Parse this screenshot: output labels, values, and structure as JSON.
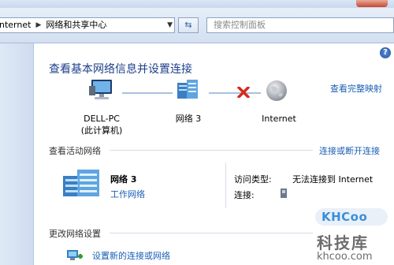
{
  "window": {
    "breadcrumb_start": "nternet",
    "breadcrumb_current": "网络和共享中心",
    "search_placeholder": "搜索控制面板"
  },
  "main": {
    "title": "查看基本网络信息并设置连接",
    "full_map_link": "查看完整映射",
    "map": {
      "computer_name": "DELL-PC",
      "computer_sub": "(此计算机)",
      "network_name": "网络  3",
      "internet_name": "Internet"
    },
    "active_networks": {
      "title": "查看活动网络",
      "connect_link": "连接或断开连接",
      "network_name": "网络  3",
      "network_type": "工作网络",
      "access_type_label": "访问类型:",
      "access_type_value": "无法连接到 Internet",
      "connections_label": "连接:"
    },
    "change_settings": {
      "title": "更改网络设置",
      "setup_link": "设置新的连接或网络"
    }
  },
  "watermark": {
    "logo_text": "KHCoo",
    "cn_text": "科技库",
    "domain": "khcoo.com"
  },
  "colors": {
    "link": "#1b5fb4",
    "title": "#1e3f8a",
    "error_x": "#d62a1f"
  },
  "icons": [
    "back-icon",
    "breadcrumb-separator-icon",
    "dropdown-arrow-icon",
    "refresh-icon",
    "help-icon",
    "computer-icon",
    "network-icon",
    "red-x-icon",
    "globe-icon",
    "network-building-icon",
    "connection-icon",
    "setup-connection-icon"
  ]
}
